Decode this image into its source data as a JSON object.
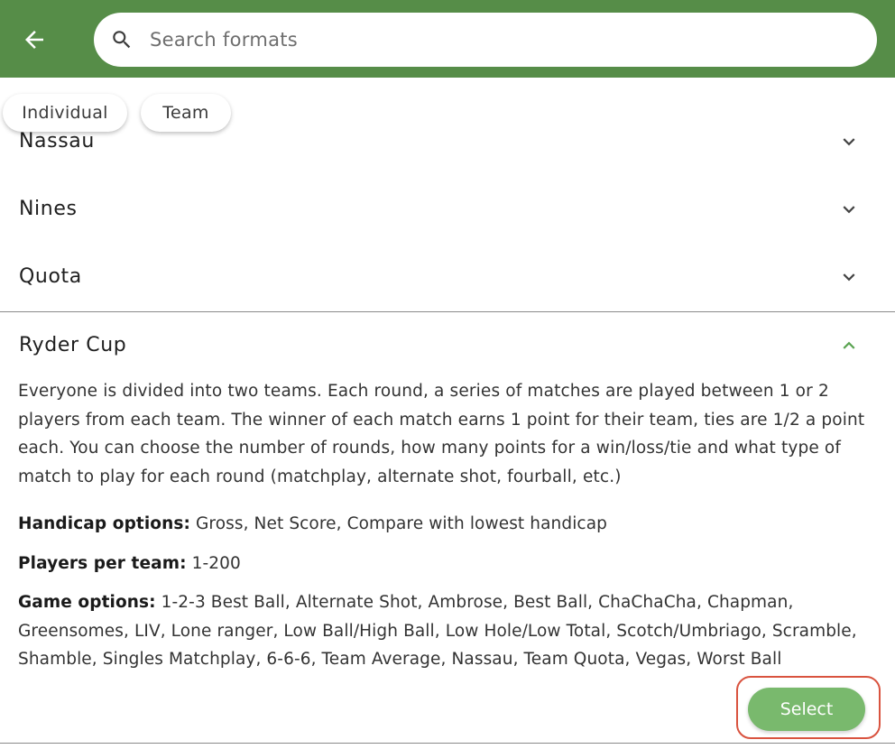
{
  "colors": {
    "app_bar": "#568d48",
    "accent_chevron": "#5aa351",
    "select_button": "#79b96d",
    "highlight_outline": "#d9533f"
  },
  "header": {
    "back_icon": "arrow-back-icon",
    "search": {
      "icon": "search-icon",
      "placeholder": "Search formats",
      "value": ""
    }
  },
  "filters": {
    "chips": [
      "Individual",
      "Team"
    ]
  },
  "formats": [
    {
      "label": "Nassau",
      "expanded": false,
      "icon": "chevron-down-icon"
    },
    {
      "label": "Nines",
      "expanded": false,
      "icon": "chevron-down-icon"
    },
    {
      "label": "Quota",
      "expanded": false,
      "icon": "chevron-down-icon"
    },
    {
      "label": "Ryder Cup",
      "expanded": true,
      "icon": "chevron-up-icon"
    }
  ],
  "expanded": {
    "description": "Everyone is divided into two teams. Each round, a series of matches are played between 1 or 2 players from each team. The winner of each match earns 1 point for their team, ties are 1/2 a point each. You can choose the number of rounds, how many points for a win/loss/tie and what type of match to play for each round (matchplay, alternate shot, fourball, etc.)",
    "handicap": {
      "label": "Handicap options:",
      "value": "Gross, Net Score, Compare with lowest handicap"
    },
    "players": {
      "label": "Players per team:",
      "value": "1-200"
    },
    "game_options": {
      "label": "Game options:",
      "value": "1-2-3 Best Ball, Alternate Shot, Ambrose, Best Ball, ChaChaCha, Chapman, Greensomes, LIV, Lone ranger, Low Ball/High Ball, Low Hole/Low Total, Scotch/Umbriago, Scramble, Shamble, Singles Matchplay, 6-6-6, Team Average, Nassau, Team Quota, Vegas, Worst Ball"
    },
    "select_label": "Select"
  }
}
